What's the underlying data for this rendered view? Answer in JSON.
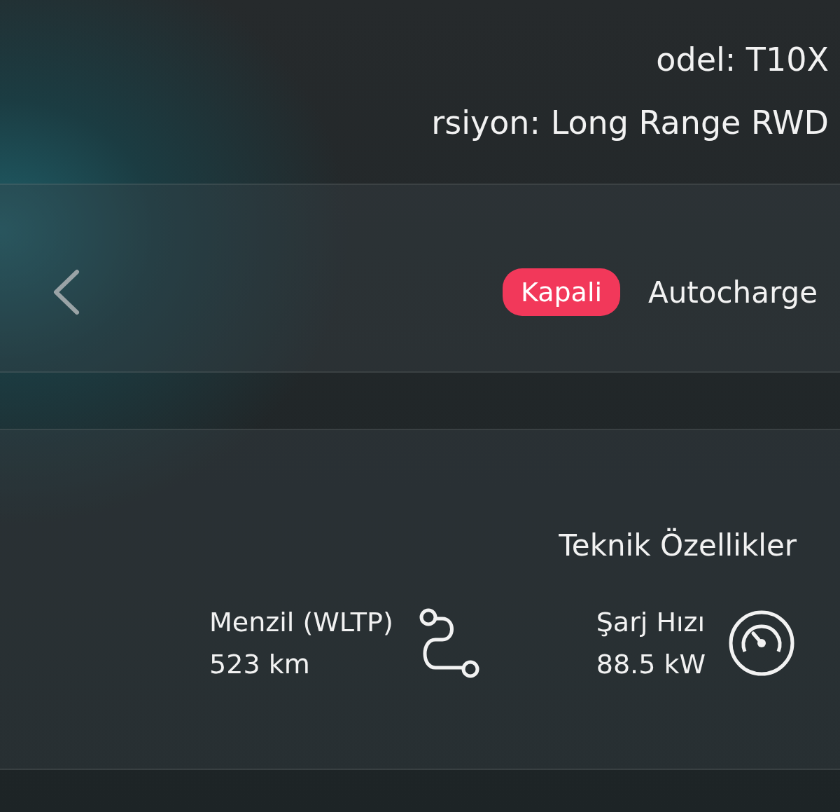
{
  "vehicle": {
    "model": "odel: T10X",
    "version": "rsiyon: Long Range RWD"
  },
  "autocharge": {
    "label": "Autocharge",
    "status": "Kapali",
    "on": false
  },
  "specs": {
    "title": "Teknik Özellikler",
    "items": [
      {
        "kind": "range",
        "label": "Menzil (WLTP)",
        "value": "523 km"
      },
      {
        "kind": "charge",
        "label": "Şarj Hızı",
        "value": "88.5 kW"
      }
    ]
  }
}
